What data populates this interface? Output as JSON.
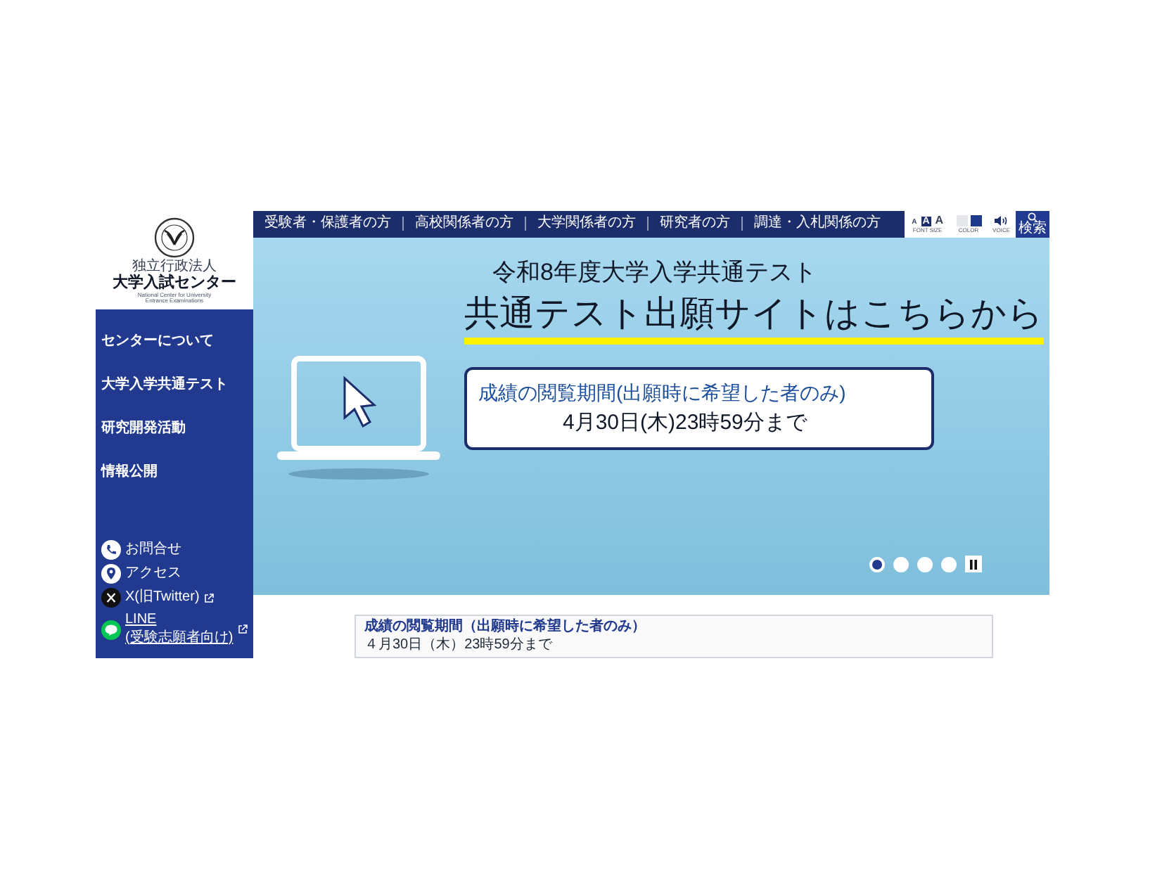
{
  "logo": {
    "org_type": "独立行政法人",
    "name": "大学入試センター",
    "name_en": "National Center for University Entrance Examinations"
  },
  "nav": [
    {
      "label": "受験者・保護者の方"
    },
    {
      "label": "高校関係者の方"
    },
    {
      "label": "大学関係者の方"
    },
    {
      "label": "研究者の方"
    },
    {
      "label": "調達・入札関係の方"
    }
  ],
  "tools": {
    "font_size": {
      "label": "FONT SIZE",
      "options": [
        {
          "label": "A",
          "selected": false
        },
        {
          "label": "A",
          "selected": true
        },
        {
          "label": "A",
          "selected": false
        }
      ]
    },
    "color": {
      "label": "COLOR",
      "swatches": [
        {
          "color": "#e5e7eb"
        },
        {
          "color": "#1e3a8a"
        }
      ]
    },
    "voice": {
      "label": "VOICE"
    },
    "search": {
      "label": "検索"
    }
  },
  "sidebar": {
    "items": [
      {
        "label": "センターについて"
      },
      {
        "label": "大学入学共通テスト"
      },
      {
        "label": "研究開発活動"
      },
      {
        "label": "情報公開"
      }
    ],
    "links": [
      {
        "kind": "phone",
        "label": "お問合せ",
        "external": false
      },
      {
        "kind": "pin",
        "label": "アクセス",
        "external": false
      },
      {
        "kind": "x",
        "label": "X(旧Twitter)",
        "external": true
      },
      {
        "kind": "line",
        "label": "LINE",
        "sublabel": "(受験志願者向け)",
        "external": true
      }
    ]
  },
  "hero": {
    "subtitle": "令和8年度大学入学共通テスト",
    "title": "共通テスト出願サイトはこちらから",
    "notice": {
      "heading": "成績の閲覧期間(出願時に希望した者のみ)",
      "date": "4月30日(木)23時59分まで"
    },
    "slides": [
      {
        "selected": true
      },
      {
        "selected": false
      },
      {
        "selected": false
      },
      {
        "selected": false
      }
    ],
    "playing": true
  },
  "notice_card": {
    "heading": "成績の閲覧期間（出願時に希望した者のみ）",
    "date": "４月30日（木）23時59分まで"
  }
}
